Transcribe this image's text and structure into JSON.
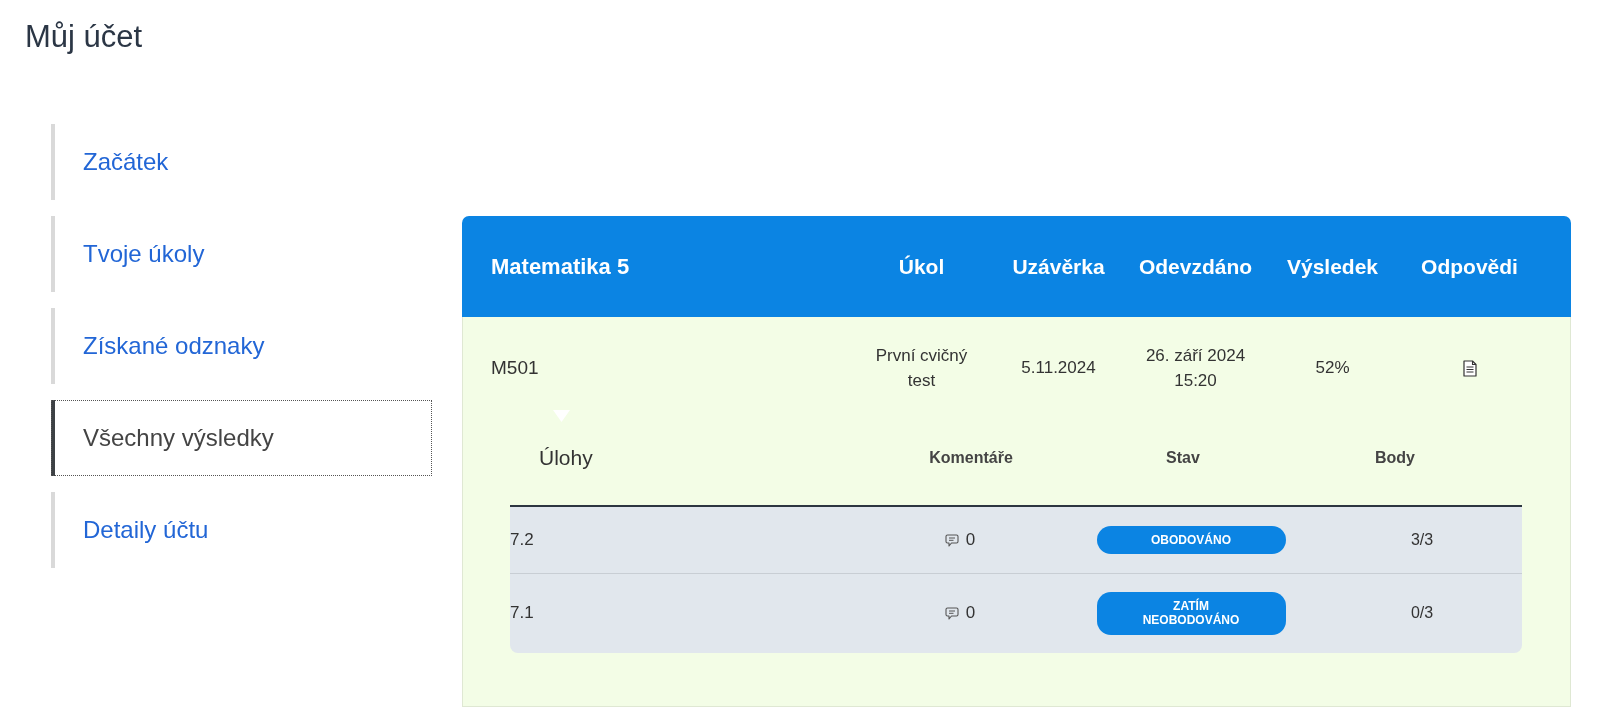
{
  "page": {
    "title": "Můj účet"
  },
  "sidebar": {
    "items": [
      {
        "label": "Začátek",
        "selected": false
      },
      {
        "label": "Tvoje úkoly",
        "selected": false
      },
      {
        "label": "Získané odznaky",
        "selected": false
      },
      {
        "label": "Všechny výsledky",
        "selected": true
      },
      {
        "label": "Detaily účtu",
        "selected": false
      }
    ]
  },
  "course": {
    "title": "Matematika 5",
    "columns": [
      "Úkol",
      "Uzávěrka",
      "Odevzdáno",
      "Výsledek",
      "Odpovědi"
    ],
    "assignments": [
      {
        "name": "M501",
        "task": "První cvičný test",
        "deadline": "5.11.2024",
        "submitted": "26. září 2024 15:20",
        "result": "52%",
        "expanded": true,
        "details": {
          "columns": [
            "Úlohy",
            "Komentáře",
            "Stav",
            "Body"
          ],
          "rows": [
            {
              "task": "7.2",
              "comments": "0",
              "status": "OBODOVÁNO",
              "points": "3/3"
            },
            {
              "task": "7.1",
              "comments": "0",
              "status": "ZATÍM NEOBODOVÁNO",
              "points": "0/3"
            }
          ]
        }
      }
    ]
  }
}
